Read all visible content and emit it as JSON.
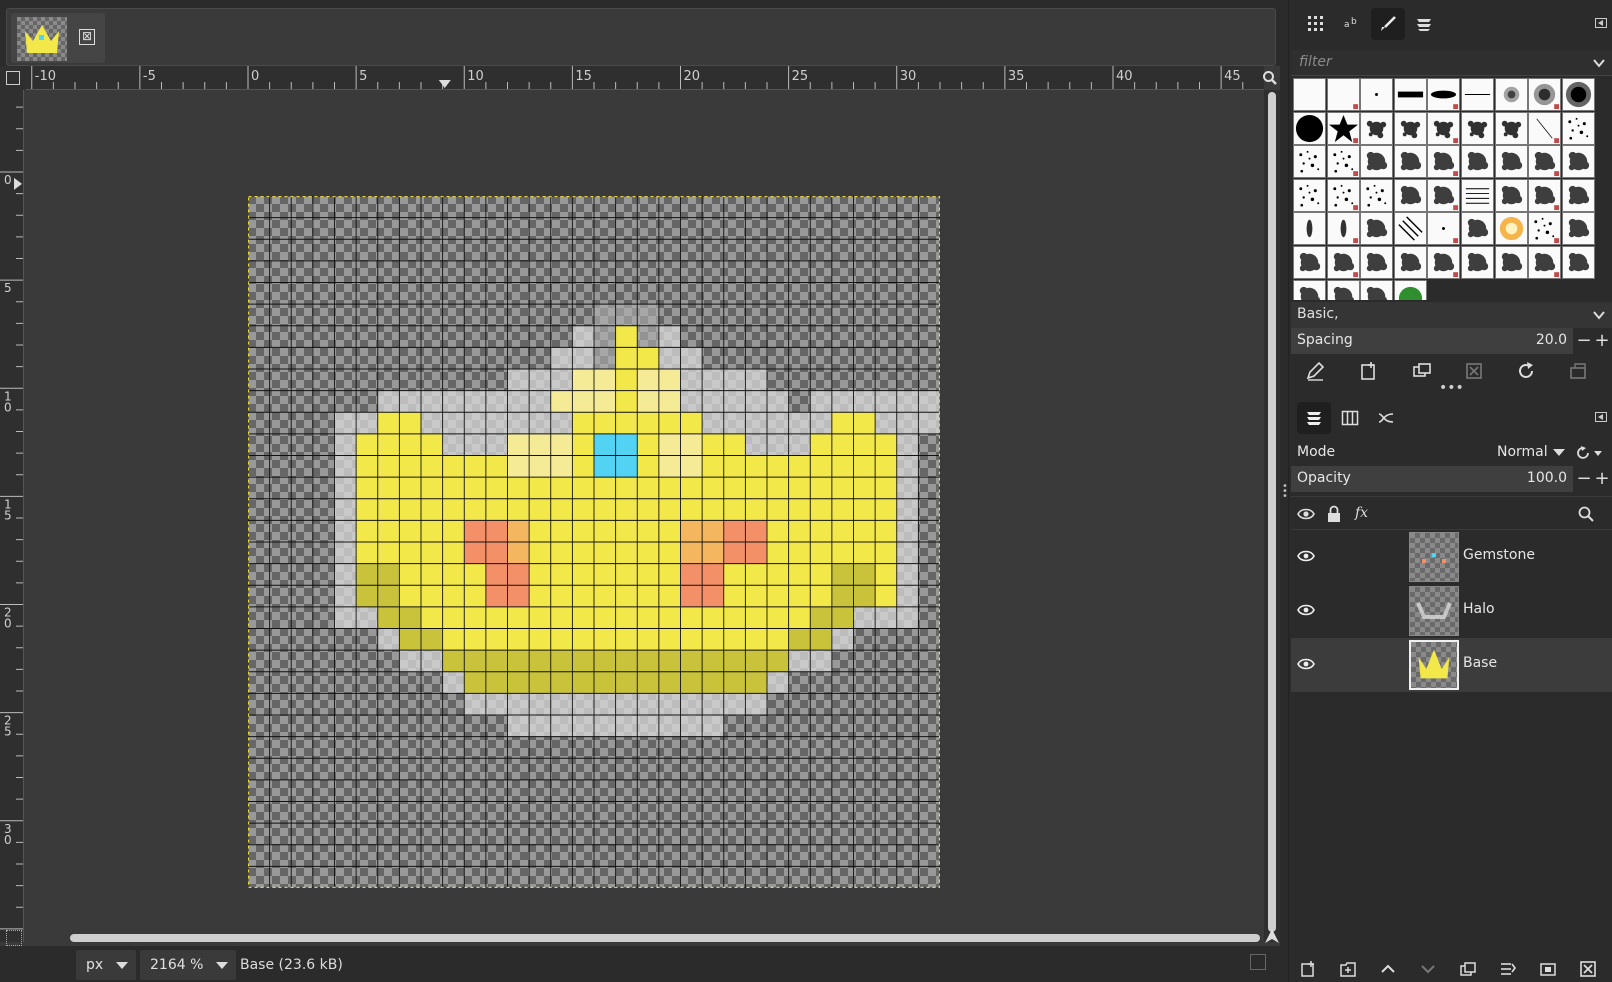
{
  "image_tab": {
    "close_glyph": "⊠"
  },
  "ruler": {
    "h_labels": [
      "-10",
      "-5",
      "0",
      "5",
      "10",
      "15",
      "20",
      "25",
      "30",
      "35",
      "40",
      "45"
    ],
    "v_labels": [
      "0",
      "5",
      "10",
      "15",
      "20",
      "25",
      "30"
    ]
  },
  "canvas": {
    "grid_size": 32,
    "colors": {
      "Y": "#f3e84a",
      "D": "#c9c23b",
      "L": "#f5eb97",
      "O": "#f39068",
      "P": "#f4b75f",
      "C": "#52d3f4",
      "H": "#d9d9d9",
      "T": "#b0b0b0"
    },
    "rows": [
      "................................",
      "................................",
      "................................",
      "................................",
      "................................",
      "................TTT.............",
      "...............HTYTH............",
      "..............HHTYYHH...........",
      "............HHHLLYLLHHHH........",
      "......HHHHHHHHLLLYLLHHHHH.HHHHHH",
      "....HHYYHHHHHHHYYYYYYHHHHHHYYHHH",
      "....HYYYYHHHLLLYCCYLLYYHHHYYYYH.",
      "....HYYYYYYYLLLYCCYLLYYYYYYYYYH.",
      "....HYYYYYYYYYYYYYYYYYYYYYYYYYH.",
      "....HYYYYYYYYYYYYYYYYYYYYYYYYYH.",
      "....HYYYYYOOPYYYYYYYPPOOYYYYYYH.",
      "....HYYYYYOOPYYYYYYYPPOOYYYYYYH.",
      "....HDDYYYYOOYYYYYYYOOYYYYYDDYH.",
      "....HDDYYYYOOYYYYYYYOOYYYYYDDYH.",
      "....HHDDYYYYYYYYYYYYYYYYYYDDHHH.",
      "......HDDYYYYYYYYYYYYYYYYDDH....",
      ".......HHDDDDDDDDDDDDDDDDHH.....",
      ".........HDDDDDDDDDDDDDDH.......",
      "..........HHHHHHHHHHHHHH........",
      "............HHHHHHHHHH..........",
      "................................",
      "................................",
      "................................",
      "................................",
      "................................",
      "................................",
      "................................"
    ]
  },
  "statusbar": {
    "unit": "px",
    "zoom": "2164 %",
    "info": "Base (23.6 kB)"
  },
  "brushes": {
    "filter_placeholder": "filter",
    "tag": "Basic,",
    "spacing_label": "Spacing",
    "spacing_value": "20.0",
    "minus": "−",
    "plus": "+"
  },
  "layers": {
    "mode_label": "Mode",
    "mode_value": "Normal",
    "opacity_label": "Opacity",
    "opacity_value": "100.0",
    "fx_label": "fx",
    "items": [
      {
        "name": "Gemstone"
      },
      {
        "name": "Halo"
      },
      {
        "name": "Base"
      }
    ]
  }
}
